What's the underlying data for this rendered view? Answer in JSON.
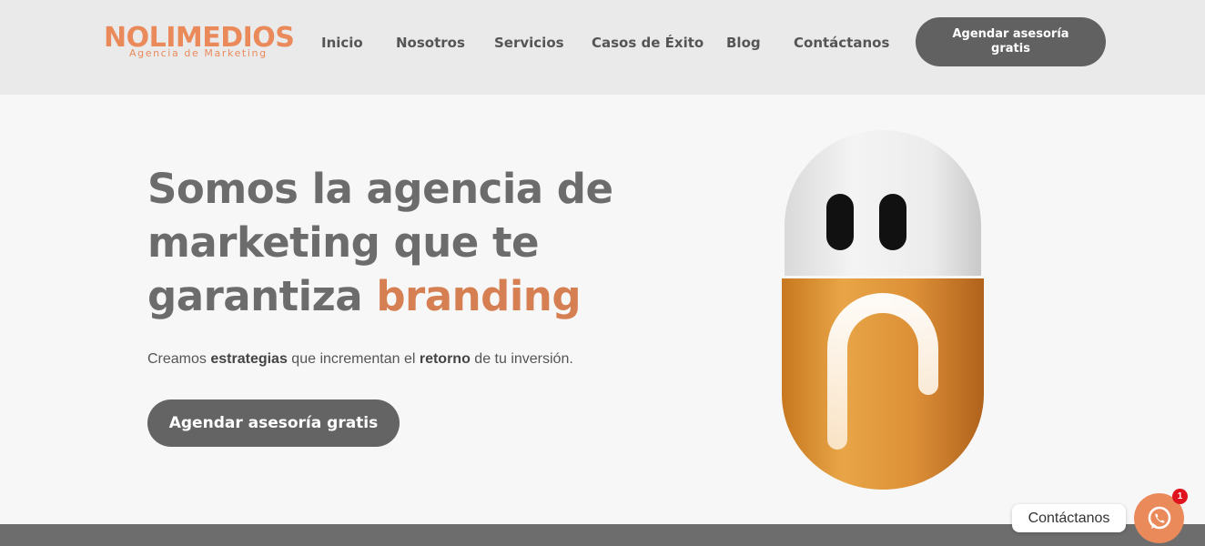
{
  "header": {
    "logo": {
      "word": "NOLIMEDIOS",
      "tagline": "Agencia de Marketing"
    },
    "nav": [
      {
        "label": "Inicio"
      },
      {
        "label": "Nosotros"
      },
      {
        "label": "Servicios"
      },
      {
        "label": "Casos de Éxito"
      },
      {
        "label": "Blog"
      },
      {
        "label": "Contáctanos"
      }
    ],
    "cta_label": "Agendar asesoría gratis"
  },
  "hero": {
    "title_line1": "Somos la agencia de",
    "title_line2": "marketing que te",
    "title_line3_plain": "garantiza ",
    "title_line3_accent": "branding",
    "sub_part1": "Creamos ",
    "sub_bold1": "estrategias",
    "sub_part2": " que incrementan el ",
    "sub_bold2": "retorno",
    "sub_part3": " de tu inversión.",
    "cta_label": "Agendar asesoría gratis"
  },
  "chat": {
    "label": "Contáctanos",
    "badge_count": "1",
    "icon": "whatsapp-icon"
  },
  "colors": {
    "accent": "#d57f52",
    "brand_orange": "#ea8a5b",
    "button_gray": "#616161",
    "header_bg": "#eaeaea",
    "page_bg": "#f7f7f7",
    "badge_red": "#e0141e"
  }
}
